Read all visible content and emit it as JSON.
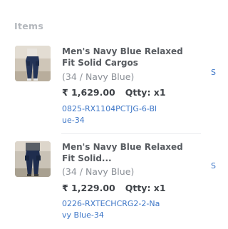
{
  "section": {
    "heading": "Items"
  },
  "items": [
    {
      "title": "Men's Navy Blue Relaxed Fit Solid Cargos",
      "variant": "(34 / Navy Blue)",
      "price": "₹ 1,629.00",
      "qty": "Qtty: x1",
      "sku": "0825-RX1104PCTJG-6-Blue-34",
      "edge_link": "S"
    },
    {
      "title": "Men's Navy Blue Relaxed Fit Solid...",
      "variant": "(34 / Navy Blue)",
      "price": "₹ 1,229.00",
      "qty": "Qtty: x1",
      "sku": "0226-RXTECHCRG2-2-Navy Blue-34",
      "edge_link": "S"
    }
  ],
  "colors": {
    "heading": "#b4b8bd",
    "title": "#575b60",
    "variant": "#8a8f96",
    "price": "#3f4348",
    "link": "#3d76c7"
  }
}
